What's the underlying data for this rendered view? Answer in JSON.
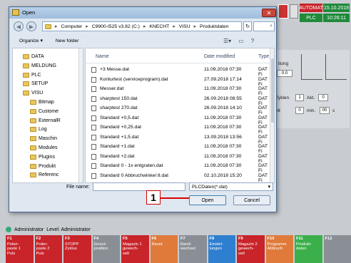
{
  "status": {
    "mode": "AUTOMAT",
    "state": "PLC",
    "date": "15.10.2018",
    "time": "10:26:11"
  },
  "bg_panel": {
    "lung": "itung",
    "val1": "0.0",
    "cycles_label": "Zyklen",
    "cycles_val": "1",
    "akt_label": "Akt.",
    "akt_val": "0",
    "zeit_label": "eit",
    "zeit_val": "0",
    "min_label": "min.",
    "sec_val": "00",
    "s_label": "s"
  },
  "dialog": {
    "title": "Open",
    "close": "✕",
    "path": [
      "Computer",
      "C9900-I525 v3.82 (C:)",
      "KNECHT",
      "VISU",
      "Produktdaten"
    ],
    "organize": "Organize ▾",
    "new_folder": "New folder",
    "tree": [
      "DATA",
      "MELDUNG",
      "PLC",
      "SETUP",
      "VISU",
      "Bitmap",
      "Custome",
      "ExternalR",
      "Log",
      "Maschin",
      "Modules",
      "Plugins",
      "Produkt",
      "Referenc"
    ],
    "columns": {
      "name": "Name",
      "date": "Date modified",
      "type": "Type"
    },
    "files": [
      {
        "name": "+3 Messe.dat",
        "date": "11.09.2018 07:30",
        "type": "DAT Fi"
      },
      {
        "name": "Konturtest (serviceprogram).dat",
        "date": "27.09.2018 17:14",
        "type": "DAT Fi"
      },
      {
        "name": "Messer.dat",
        "date": "11.09.2018 07:30",
        "type": "DAT Fi"
      },
      {
        "name": "sharptest 150.dat",
        "date": "26.09.2018 08:55",
        "type": "DAT Fi"
      },
      {
        "name": "sharptest 270.dat",
        "date": "26.09.2018 14:10",
        "type": "DAT Fi"
      },
      {
        "name": "Standard +0,5.dat",
        "date": "11.09.2018 07:30",
        "type": "DAT Fi"
      },
      {
        "name": "Standard +0,25.dat",
        "date": "11.09.2018 07:30",
        "type": "DAT Fi"
      },
      {
        "name": "Standard +1,5.dat",
        "date": "13.09.2018 13:56",
        "type": "DAT Fi"
      },
      {
        "name": "Standard +1.dat",
        "date": "11.09.2018 07:30",
        "type": "DAT Fi"
      },
      {
        "name": "Standard +2.dat",
        "date": "11.09.2018 07:30",
        "type": "DAT Fi"
      },
      {
        "name": "Standard 0 - 1x entgraten.dat",
        "date": "11.09.2018 07:30",
        "type": "DAT Fi"
      },
      {
        "name": "Standard 0 Abbruchwinkel 8.dat",
        "date": "02.10.2018 15:20",
        "type": "DAT Fi"
      }
    ],
    "filename_label": "File name:",
    "filename_value": "",
    "filetype": "PLCDaten(*.dat)",
    "open": "Open",
    "cancel": "Cancel"
  },
  "callout": "1",
  "user": {
    "name": "Administrator",
    "level": "Level: Administrator"
  },
  "fkeys": [
    {
      "key": "F1",
      "label": "Polier-\npaste 1\nPuls",
      "color": "#c8242a"
    },
    {
      "key": "F2",
      "label": "Polier-\npaste 2\nPuls",
      "color": "#c8242a"
    },
    {
      "key": "F3",
      "label": "STOPP\nZyklus",
      "color": "#c8242a"
    },
    {
      "key": "F4",
      "label": "Grund-\nposition",
      "color": "#8a8f96"
    },
    {
      "key": "F5",
      "label": "Magazin 1\ngewech-\nselt",
      "color": "#c8242a"
    },
    {
      "key": "F6",
      "label": "Reset",
      "color": "#e07a3a"
    },
    {
      "key": "F7",
      "label": "Band-\nwechsel",
      "color": "#8a8f96"
    },
    {
      "key": "F8",
      "label": "Einstel-\nlungen",
      "color": "#2f7fd1"
    },
    {
      "key": "F9",
      "label": "Magazin 2\ngewech-\nselt",
      "color": "#c8242a"
    },
    {
      "key": "F10",
      "label": "Programm\nAbbruch",
      "color": "#e07a3a"
    },
    {
      "key": "F11",
      "label": "Produkt-\ndaten",
      "color": "#3bb04a"
    },
    {
      "key": "F12",
      "label": "",
      "color": "#8a8f96"
    }
  ]
}
